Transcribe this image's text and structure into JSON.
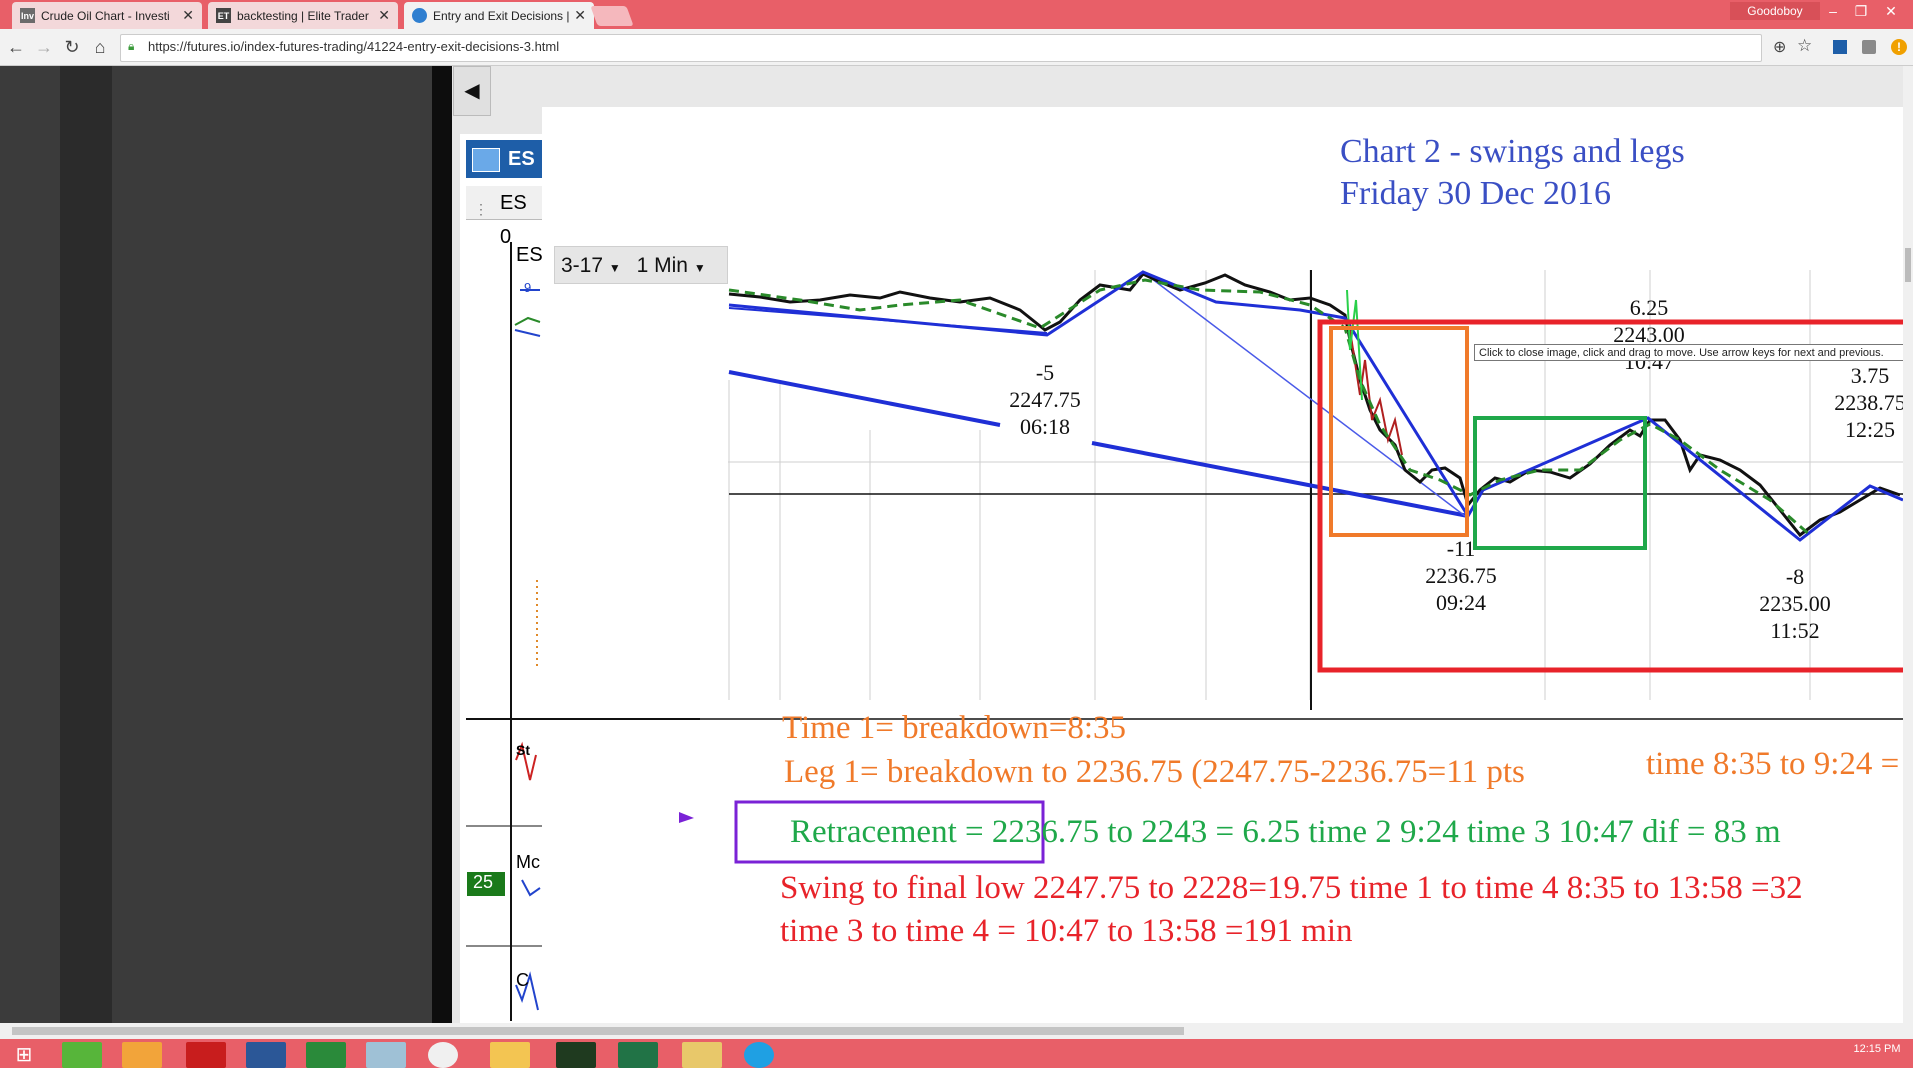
{
  "browser": {
    "tabs": [
      {
        "label": "Crude Oil Chart - Investi",
        "icon": "investing-favicon",
        "fav_text": "Inv",
        "fav_color": "#6b6b6b"
      },
      {
        "label": "backtesting | Elite Trader",
        "icon": "elitetrader-favicon",
        "fav_text": "ET",
        "fav_color": "#444444"
      },
      {
        "label": "Entry and Exit Decisions |",
        "icon": "futuresio-favicon",
        "fav_text": "",
        "fav_color": "#2f7fd0",
        "active": true
      }
    ],
    "user_name": "Goodoboy",
    "url": "https://futures.io/index-futures-trading/41224-entry-exit-decisions-3.html",
    "nav_icons": [
      "back-arrow-icon",
      "forward-arrow-icon",
      "reload-icon",
      "home-icon",
      "lock-icon"
    ],
    "omnibox_icons": [
      "zoom-icon",
      "star-icon"
    ],
    "extension_icons": [
      "extension-icon",
      "extension-icon",
      "alert-icon"
    ]
  },
  "app": {
    "symbol": "ES",
    "symbol2": "ES 0",
    "dropdown_contract": "3-17",
    "dropdown_interval": "1 Min",
    "left_side_fragments": [
      "ES",
      "9",
      "St",
      "Mc",
      "25",
      "C"
    ]
  },
  "overlay": {
    "tooltip": "Click to close image, click and drag to move. Use arrow keys for next and previous."
  },
  "chart": {
    "title_line1": "Chart 2 - swings and legs",
    "title_line2": "Friday 30 Dec 2016",
    "annotations": [
      {
        "id": "a1",
        "lines": [
          "-5",
          "2247.75",
          "06:18"
        ]
      },
      {
        "id": "a2",
        "lines": [
          "6.25",
          "2243.00",
          "10:47"
        ]
      },
      {
        "id": "a3",
        "lines": [
          "-11",
          "2236.75",
          "09:24"
        ]
      },
      {
        "id": "a4",
        "lines": [
          "3.75",
          "2238.75",
          "12:25"
        ]
      },
      {
        "id": "a5",
        "lines": [
          "-8",
          "2235.00",
          "11:52"
        ]
      }
    ],
    "notes": {
      "time1": "Time 1= breakdown=8:35",
      "leg1": "Leg 1= breakdown to 2236.75 (2247.75-2236.75=11 pts",
      "leg1_time": "time 8:35 to 9:24 =",
      "retracement": "Retracement = 2236.75 to 2243 = 6.25  time 2 9:24 time 3 10:47 dif = 83 m",
      "swing": "Swing to final low 2247.75 to 2228=19.75 time 1 to time 4 8:35 to 13:58 =32",
      "time34": "time 3 to time 4 = 10:47 to 13:58 =191 min"
    },
    "colors": {
      "title": "#3a4fc4",
      "orange": "#f07a2a",
      "green": "#1fa84a",
      "red": "#e8232a",
      "blue": "#1f2fd6",
      "purple": "#7a22d6",
      "dashed_ma": "#2a8a2a"
    }
  },
  "taskbar": {
    "icons": [
      "windows-start-icon",
      "utorrent-icon",
      "media-player-icon",
      "acrobat-icon",
      "word-icon",
      "store-icon",
      "app-icon",
      "chrome-icon",
      "file-explorer-icon",
      "cannabis-app-icon",
      "excel-icon",
      "folder-icon",
      "skype-icon"
    ],
    "clock_time": "12:15 PM"
  }
}
